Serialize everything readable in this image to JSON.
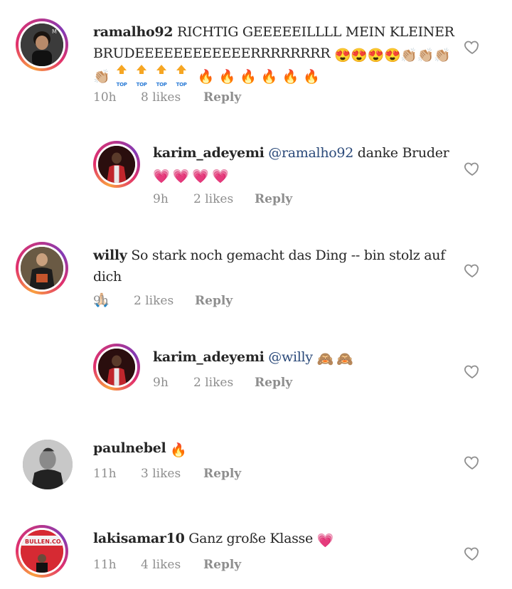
{
  "comments": [
    {
      "username": "ramalho92",
      "text_line1": "RICHTIG GEEEEEILLLL MEIN KLEINER",
      "text_line2": "BRUDEEEEEEEEEEEERRRRRRRR",
      "emojis_line2": "😍😍😍😍👏🏼👏🏼👏🏼",
      "emojis_line3_start": "👏🏼",
      "top_label": "TOP",
      "emojis_line3_end": "🔥🔥🔥🔥🔥🔥",
      "time": "10h",
      "likes": "8 likes",
      "reply": "Reply"
    },
    {
      "username": "karim_adeyemi",
      "mention": "@ramalho92",
      "text": "danke Bruder",
      "emojis_line2": "💗💗💗💗",
      "time": "9h",
      "likes": "2 likes",
      "reply": "Reply"
    },
    {
      "username": "willy",
      "text": "So stark noch gemacht das Ding -- bin stolz auf dich",
      "emojis_line2": "🙏🏻",
      "time": "9h",
      "likes": "2 likes",
      "reply": "Reply"
    },
    {
      "username": "karim_adeyemi",
      "mention": "@willy",
      "emojis": "🙈🙈",
      "time": "9h",
      "likes": "2 likes",
      "reply": "Reply"
    },
    {
      "username": "paulnebel",
      "emojis": "🔥",
      "time": "11h",
      "likes": "3 likes",
      "reply": "Reply"
    },
    {
      "username": "lakisamar10",
      "text": "Ganz große Klasse",
      "emojis": "💗",
      "avatar_text": "BULLEN.COM",
      "time": "11h",
      "likes": "4 likes",
      "reply": "Reply"
    }
  ],
  "icons": {
    "like": "heart-outline-icon"
  },
  "colors": {
    "text": "#262626",
    "meta": "#8e8e8e",
    "mention": "#2b4a7a",
    "story_ring": "#e1306c"
  }
}
